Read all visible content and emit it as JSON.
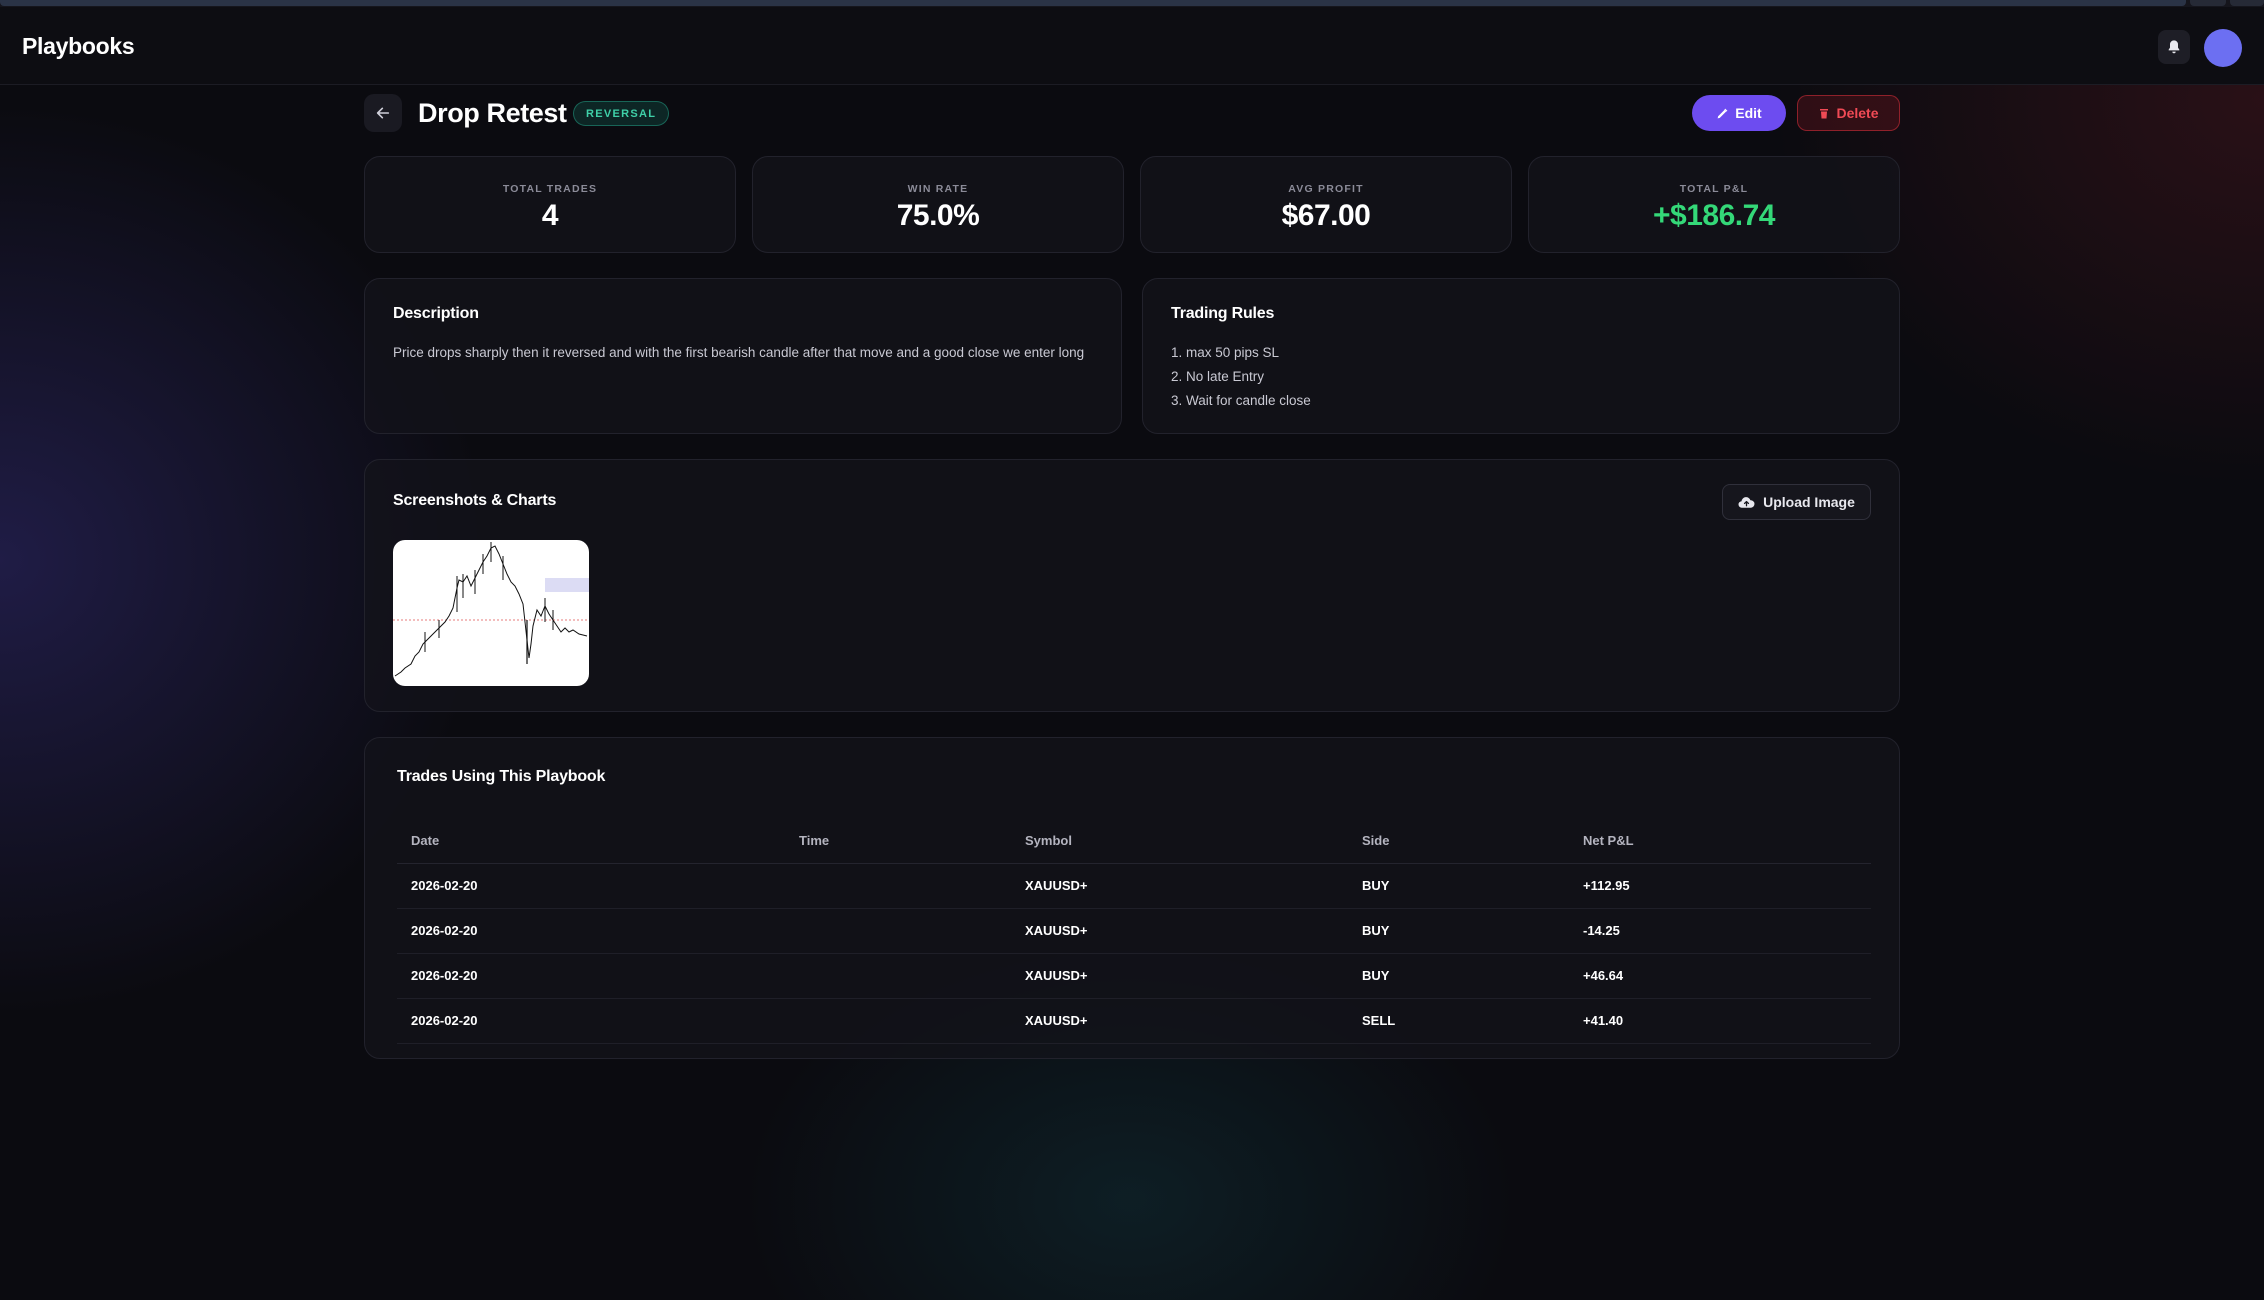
{
  "app": {
    "title": "Playbooks"
  },
  "playbook": {
    "title": "Drop Retest",
    "tag": "REVERSAL",
    "edit_label": "Edit",
    "delete_label": "Delete"
  },
  "stats": [
    {
      "label": "TOTAL TRADES",
      "value": "4",
      "tone": "neutral"
    },
    {
      "label": "WIN RATE",
      "value": "75.0%",
      "tone": "neutral"
    },
    {
      "label": "AVG PROFIT",
      "value": "$67.00",
      "tone": "neutral"
    },
    {
      "label": "TOTAL P&L",
      "value": "+$186.74",
      "tone": "positive"
    }
  ],
  "description": {
    "title": "Description",
    "text": "Price drops sharply then it reversed and with the first bearish candle after that move and a good close we enter long"
  },
  "rules": {
    "title": "Trading Rules",
    "items": [
      "1. max 50 pips SL",
      "2. No late Entry",
      "3. Wait for candle close"
    ]
  },
  "screenshots": {
    "title": "Screenshots & Charts",
    "upload_label": "Upload Image"
  },
  "trades": {
    "title": "Trades Using This Playbook",
    "columns": [
      "Date",
      "Time",
      "Symbol",
      "Side",
      "Net P&L"
    ],
    "rows": [
      [
        "2026-02-20",
        "",
        "XAUUSD+",
        "BUY",
        "+112.95"
      ],
      [
        "2026-02-20",
        "",
        "XAUUSD+",
        "BUY",
        "-14.25"
      ],
      [
        "2026-02-20",
        "",
        "XAUUSD+",
        "BUY",
        "+46.64"
      ],
      [
        "2026-02-20",
        "",
        "XAUUSD+",
        "SELL",
        "+41.40"
      ]
    ]
  },
  "colors": {
    "accent": "#6d4cf0",
    "positive": "#34d878",
    "danger": "#f04a55",
    "tag": "#3fd0a8"
  },
  "icons": {
    "bell": "bell-icon",
    "back": "arrow-left-icon",
    "edit": "pencil-icon",
    "delete": "trash-icon",
    "upload": "cloud-upload-icon"
  }
}
